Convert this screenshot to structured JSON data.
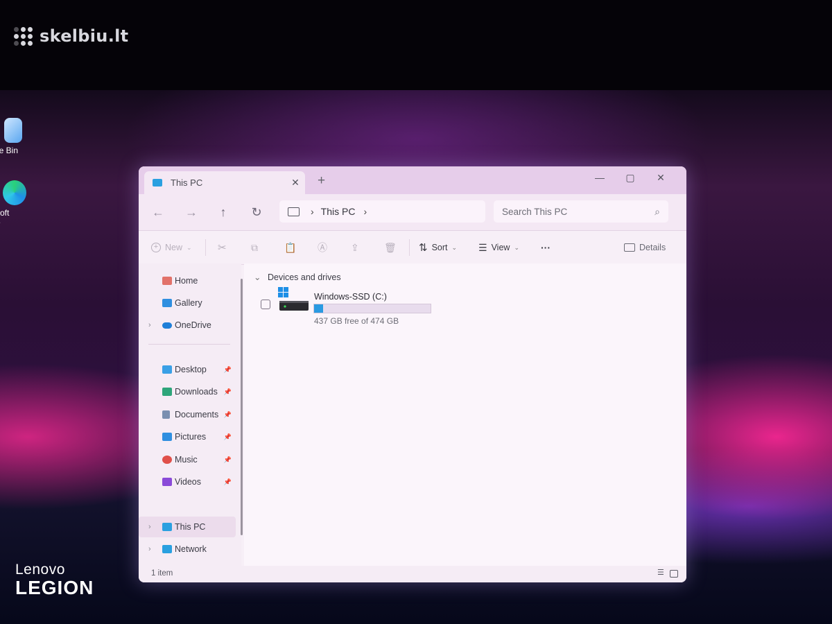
{
  "watermark": {
    "text": "skelbiu.lt"
  },
  "desktop": {
    "icons": [
      {
        "label": "le Bin"
      },
      {
        "label": "soft\ne"
      }
    ],
    "brand": {
      "line1": "Lenovo",
      "line2": "LEGION"
    }
  },
  "window": {
    "tab_title": "This PC",
    "tab_close": "✕",
    "new_tab": "+",
    "controls": {
      "minimize": "—",
      "maximize": "▢",
      "close": "✕"
    }
  },
  "nav": {
    "back": "←",
    "forward": "→",
    "up": "↑",
    "refresh": "↻",
    "breadcrumb": [
      "This PC"
    ],
    "breadcrumb_sep": "›",
    "search_placeholder": "Search This PC",
    "search_icon": "⌕"
  },
  "commands": {
    "new_label": "New",
    "sort_label": "Sort",
    "view_label": "View",
    "more_label": "···",
    "details_label": "Details"
  },
  "sidebar": {
    "chev": "›",
    "pin": "📌",
    "top": [
      {
        "label": "Home",
        "icon": "home-icon",
        "color": "#e2726a"
      },
      {
        "label": "Gallery",
        "icon": "gallery-icon",
        "color": "#2f8fe0"
      },
      {
        "label": "OneDrive",
        "icon": "cloud-icon",
        "color": "#1f7fd8"
      }
    ],
    "quick": [
      {
        "label": "Desktop",
        "icon": "desktop-icon",
        "color": "#3aa0e6"
      },
      {
        "label": "Downloads",
        "icon": "download-icon",
        "color": "#2ea57a"
      },
      {
        "label": "Documents",
        "icon": "document-icon",
        "color": "#7a8fb0"
      },
      {
        "label": "Pictures",
        "icon": "pictures-icon",
        "color": "#2f8fe0"
      },
      {
        "label": "Music",
        "icon": "music-icon",
        "color": "#e0504a"
      },
      {
        "label": "Videos",
        "icon": "video-icon",
        "color": "#8a4ad8"
      }
    ],
    "bottom": [
      {
        "label": "This PC",
        "icon": "computer-icon",
        "color": "#2aa0e0"
      },
      {
        "label": "Network",
        "icon": "network-icon",
        "color": "#2aa0e0"
      }
    ]
  },
  "content": {
    "group_header": "Devices and drives",
    "group_chevron": "⌄",
    "drives": [
      {
        "name": "Windows-SSD (C:)",
        "free_text": "437 GB free of 474 GB",
        "used_fraction": 0.078
      }
    ]
  },
  "status": {
    "item_count": "1 item"
  }
}
